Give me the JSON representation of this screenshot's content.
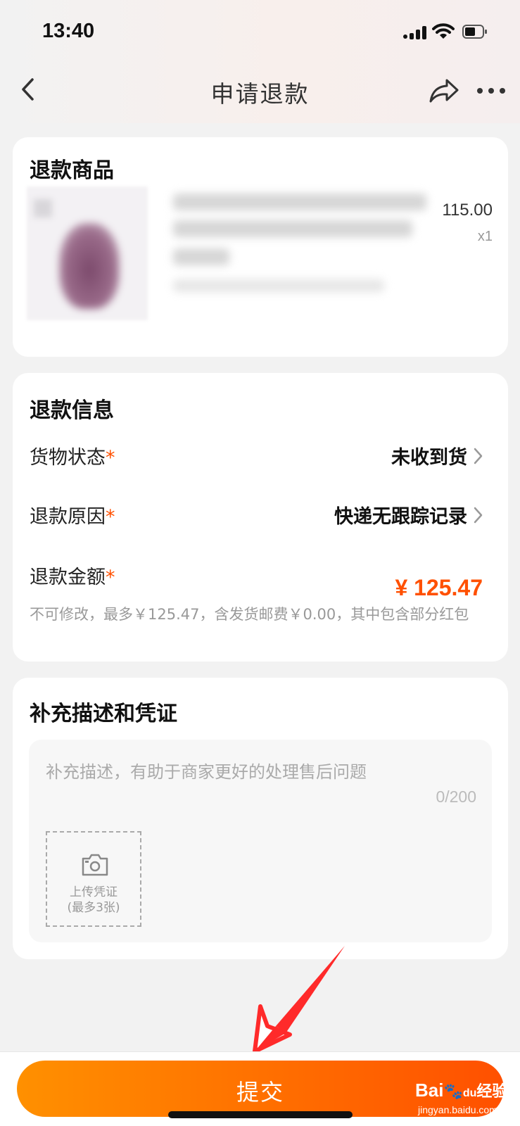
{
  "status_bar": {
    "time": "13:40"
  },
  "nav": {
    "title": "申请退款"
  },
  "product_card": {
    "title": "退款商品",
    "price": "115.00",
    "quantity": "x1"
  },
  "info_card": {
    "title": "退款信息",
    "goods_status": {
      "label": "货物状态",
      "required": "*",
      "value": "未收到货"
    },
    "refund_reason": {
      "label": "退款原因",
      "required": "*",
      "value": "快递无跟踪记录"
    },
    "refund_amount": {
      "label": "退款金额",
      "required": "*",
      "value": "¥ 125.47",
      "note": "不可修改，最多￥125.47，含发货邮费￥0.00，其中包含部分红包"
    }
  },
  "desc_card": {
    "title": "补充描述和凭证",
    "placeholder": "补充描述，有助于商家更好的处理售后问题",
    "counter": "0/200",
    "upload_label": "上传凭证",
    "upload_limit": "(最多3张)"
  },
  "bottom": {
    "submit_label": "提交",
    "watermark_brand": "Bai",
    "watermark_du": "du",
    "watermark_suffix": "经验",
    "watermark_site": "jingyan.baidu.com"
  },
  "colors": {
    "accent": "#ff5000",
    "button_start": "#ff9000",
    "button_end": "#ff5000",
    "annotation_arrow": "#ff2a2a"
  },
  "icons": [
    "back-icon",
    "share-icon",
    "more-icon",
    "chevron-right-icon",
    "camera-icon",
    "signal-icon",
    "wifi-icon",
    "battery-icon"
  ]
}
